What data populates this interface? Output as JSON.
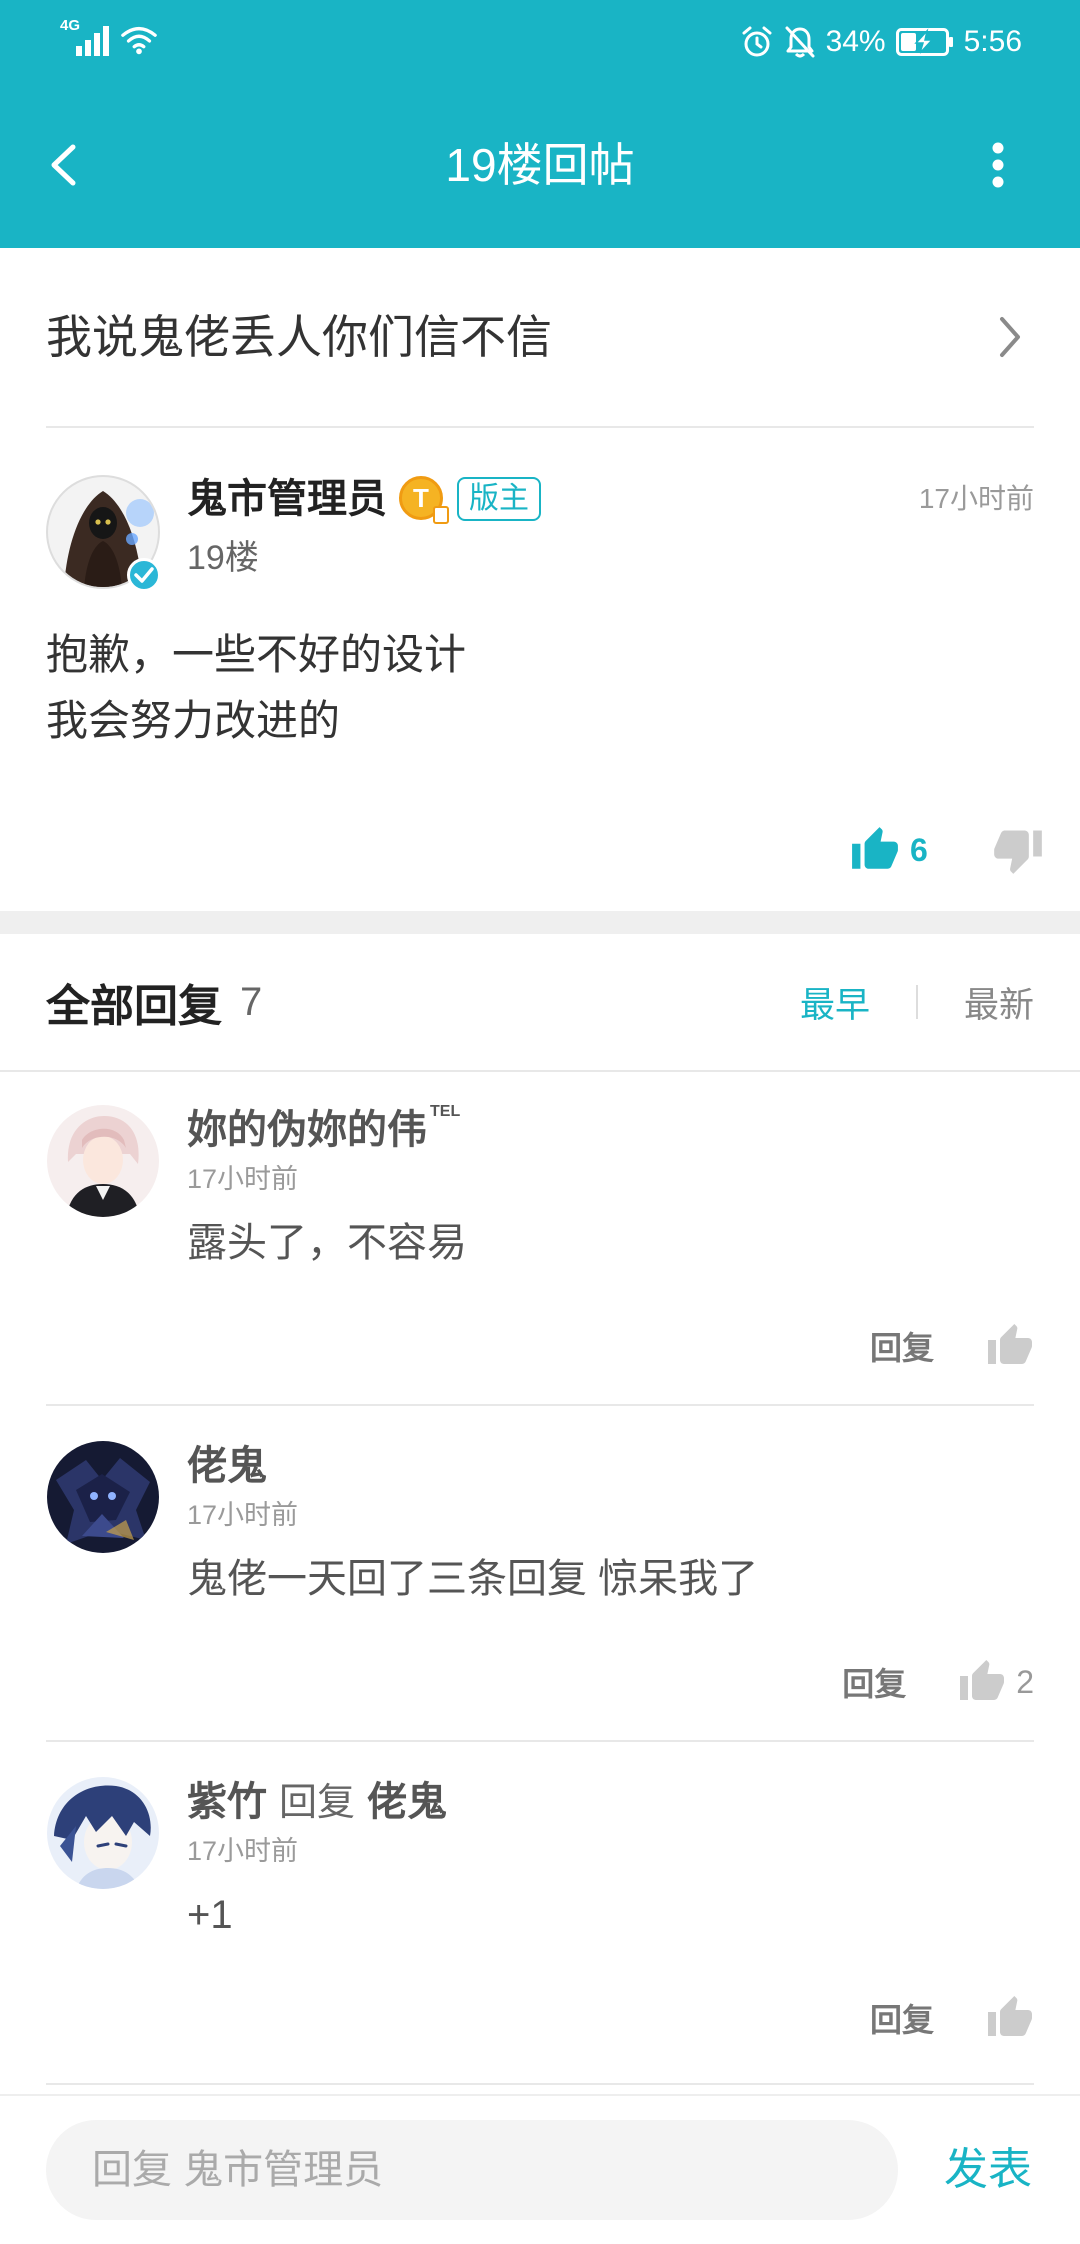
{
  "status_bar": {
    "network": "4G",
    "battery_percent": "34%",
    "battery_level": 0.34,
    "time": "5:56",
    "icons": [
      "signal-icon",
      "wifi-icon",
      "alarm-icon",
      "bell-off-icon",
      "battery-charging-icon"
    ]
  },
  "header": {
    "title": "19楼回帖",
    "back_icon": "back-arrow-icon",
    "menu_icon": "more-vertical-icon"
  },
  "thread": {
    "title": "我说鬼佬丢人你们信不信",
    "chevron_icon": "chevron-right-icon"
  },
  "post": {
    "author": "鬼市管理员",
    "verified": true,
    "level_badge": "T",
    "role_tag": "版主",
    "time": "17小时前",
    "floor": "19楼",
    "content": [
      "抱歉，一些不好的设计",
      "我会努力改进的"
    ],
    "likes": "6",
    "liked": true
  },
  "replies_section": {
    "title": "全部回复",
    "count": "7",
    "sort": [
      {
        "label": "最早",
        "active": true
      },
      {
        "label": "最新",
        "active": false
      }
    ]
  },
  "replies": [
    {
      "author": "妳的伪妳的伟",
      "author_suffix": "TEL",
      "time": "17小时前",
      "content": "露头了，不容易",
      "reply_label": "回复"
    },
    {
      "author": "佬鬼",
      "time": "17小时前",
      "content": "鬼佬一天回了三条回复 惊呆我了",
      "reply_label": "回复",
      "likes": "2"
    },
    {
      "author": "紫竹",
      "reply_word": "回复",
      "reply_to": "佬鬼",
      "time": "17小时前",
      "content": "+1",
      "reply_label": "回复"
    }
  ],
  "composer": {
    "placeholder": "回复 鬼市管理员",
    "submit_label": "发表"
  },
  "colors": {
    "accent": "#19b4c5",
    "text_primary": "#333333",
    "text_secondary": "#9a9a9a",
    "divider": "#e8e8e8",
    "like_inactive": "#cccccc",
    "badge_gold": "#f5b323"
  }
}
